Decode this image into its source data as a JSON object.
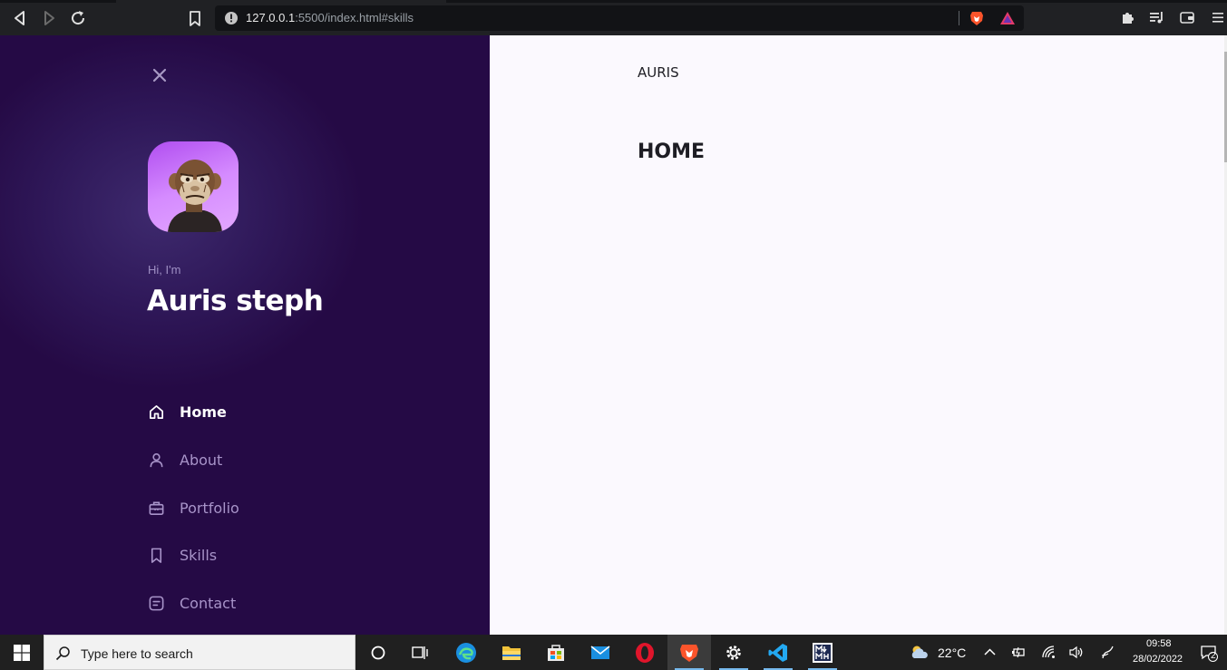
{
  "browser": {
    "url_host": "127.0.0.1",
    "url_rest": ":5500/index.html#skills"
  },
  "sidebar": {
    "greeting": "Hi, I'm",
    "name": "Auris steph",
    "menu": [
      {
        "label": "Home",
        "icon": "home-icon",
        "active": true
      },
      {
        "label": "About",
        "icon": "user-icon",
        "active": false
      },
      {
        "label": "Portfolio",
        "icon": "briefcase-icon",
        "active": false
      },
      {
        "label": "Skills",
        "icon": "bookmark-icon",
        "active": false
      },
      {
        "label": "Contact",
        "icon": "message-icon",
        "active": false
      }
    ]
  },
  "main": {
    "brand": "AURIS",
    "page_title": "HOME"
  },
  "taskbar": {
    "search_placeholder": "Type here to search",
    "weather": "22°C",
    "time": "09:58",
    "date": "28/02/2022",
    "notification_count": "2"
  },
  "colors": {
    "sidebar_bg": "#250a45",
    "accent": "#b04df0",
    "menu_muted": "#a894c9",
    "main_bg": "#fbf9fe"
  }
}
